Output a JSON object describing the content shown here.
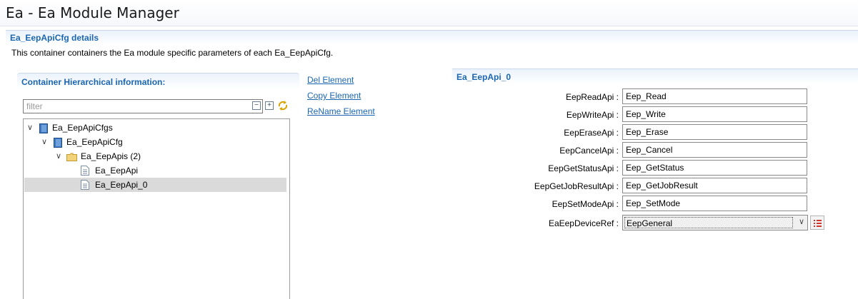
{
  "window": {
    "title": "Ea - Ea Module Manager"
  },
  "details": {
    "header": "Ea_EepApiCfg details",
    "description": "This container containers the Ea module specific parameters of each Ea_EepApiCfg."
  },
  "tree_panel": {
    "header": "Container Hierarchical information:",
    "filter_placeholder": "filter",
    "items": [
      {
        "label": "Ea_EepApiCfgs",
        "icon": "module-icon"
      },
      {
        "label": "Ea_EepApiCfg",
        "icon": "module-icon"
      },
      {
        "label": "Ea_EepApis (2)",
        "icon": "folder-icon"
      },
      {
        "label": "Ea_EepApi",
        "icon": "document-icon"
      },
      {
        "label": "Ea_EepApi_0",
        "icon": "document-icon",
        "selected": true
      }
    ]
  },
  "actions": {
    "del": "Del Element",
    "copy": "Copy Element",
    "rename": "ReName Element"
  },
  "form": {
    "header": "Ea_EepApi_0",
    "fields": [
      {
        "label": "EepReadApi :",
        "value": "Eep_Read"
      },
      {
        "label": "EepWriteApi :",
        "value": "Eep_Write"
      },
      {
        "label": "EepEraseApi :",
        "value": "Eep_Erase"
      },
      {
        "label": "EepCancelApi :",
        "value": "Eep_Cancel"
      },
      {
        "label": "EepGetStatusApi :",
        "value": "Eep_GetStatus"
      },
      {
        "label": "EepGetJobResultApi :",
        "value": "Eep_GetJobResult"
      },
      {
        "label": "EepSetModeApi :",
        "value": "Eep_SetMode"
      }
    ],
    "device_ref": {
      "label": "EaEepDeviceRef :",
      "value": "EepGeneral"
    }
  },
  "colors": {
    "accent": "#1b66b1",
    "selection": "#dadada"
  }
}
